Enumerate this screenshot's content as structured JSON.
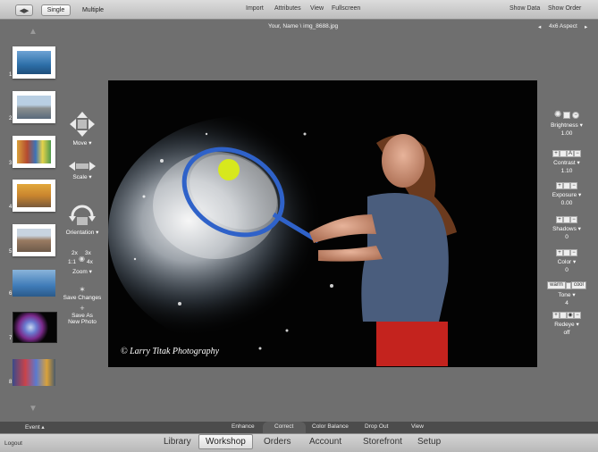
{
  "topbar": {
    "modes": [
      "Single",
      "Multiple"
    ],
    "links": [
      "Import",
      "Attributes",
      "View",
      "Fullscreen"
    ],
    "show_data": "Show Data",
    "show_order": "Show Order"
  },
  "subheader": {
    "filename": "Your, Name \\ img_8688.jpg",
    "aspect": "4x6 Aspect"
  },
  "filmstrip": {
    "numbers": [
      "1",
      "2",
      "3",
      "4",
      "5",
      "6",
      "7",
      "8"
    ]
  },
  "left_tools": {
    "move": "Move",
    "scale": "Scale",
    "orientation": "Orientation",
    "zoom_2x": "2x",
    "zoom_3x": "3x",
    "zoom_11": "1:1",
    "zoom_4x": "4x",
    "zoom": "Zoom",
    "save_changes": "Save Changes",
    "save_as": "Save As",
    "new_photo": "New Photo"
  },
  "photo": {
    "watermark": "© Larry Titak Photography"
  },
  "right_controls": {
    "brightness": {
      "label": "Brightness",
      "value": "1.00"
    },
    "contrast": {
      "label": "Contrast",
      "value": "1.10"
    },
    "exposure": {
      "label": "Exposure",
      "value": "0.00"
    },
    "shadows": {
      "label": "Shadows",
      "value": "0"
    },
    "color": {
      "label": "Color",
      "value": "0"
    },
    "tone": {
      "warm": "warm",
      "cool": "cool",
      "label": "Tone",
      "value": "4"
    },
    "redeye": {
      "label": "Redeye",
      "value": "off"
    }
  },
  "panelbar": {
    "event": "Event",
    "tabs": [
      "Enhance",
      "Correct",
      "Color Balance",
      "Drop Out",
      "View"
    ]
  },
  "nav": {
    "logout": "Logout",
    "items": [
      "Library",
      "Workshop",
      "Orders",
      "Account",
      "Storefront",
      "Setup"
    ]
  }
}
